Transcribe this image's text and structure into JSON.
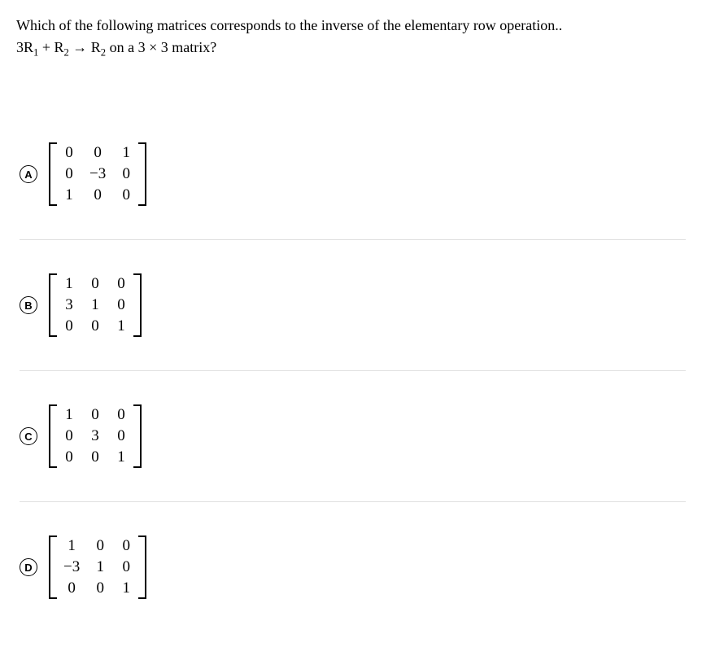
{
  "question": {
    "line1_prefix": "Which of the following matrices corresponds to the inverse of the elementary row operation..",
    "line2_prefix": "3R",
    "sub1": "1",
    "plus": " + R",
    "sub2": "2",
    "arrow": " → R",
    "sub3": "2",
    "rest": " on a  3 × 3  matrix?"
  },
  "options": [
    {
      "label": "A",
      "matrix": [
        [
          "0",
          "0",
          "1"
        ],
        [
          "0",
          "−3",
          "0"
        ],
        [
          "1",
          "0",
          "0"
        ]
      ]
    },
    {
      "label": "B",
      "matrix": [
        [
          "1",
          "0",
          "0"
        ],
        [
          "3",
          "1",
          "0"
        ],
        [
          "0",
          "0",
          "1"
        ]
      ]
    },
    {
      "label": "C",
      "matrix": [
        [
          "1",
          "0",
          "0"
        ],
        [
          "0",
          "3",
          "0"
        ],
        [
          "0",
          "0",
          "1"
        ]
      ]
    },
    {
      "label": "D",
      "matrix": [
        [
          "1",
          "0",
          "0"
        ],
        [
          "−3",
          "1",
          "0"
        ],
        [
          "0",
          "0",
          "1"
        ]
      ]
    }
  ]
}
